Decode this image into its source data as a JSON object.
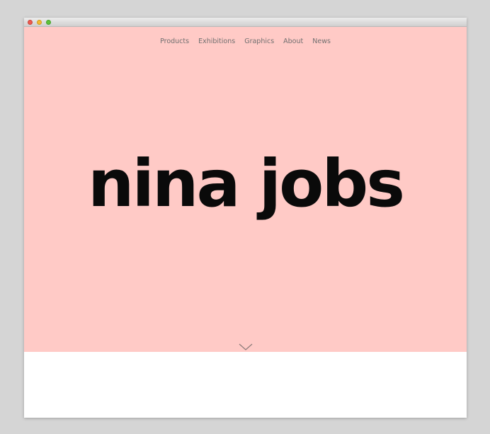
{
  "window": {
    "controls": [
      "close",
      "minimize",
      "zoom"
    ]
  },
  "nav": {
    "items": [
      {
        "label": "Products"
      },
      {
        "label": "Exhibitions"
      },
      {
        "label": "Graphics"
      },
      {
        "label": "About"
      },
      {
        "label": "News"
      }
    ]
  },
  "hero": {
    "logo_text": "nina jobs",
    "background_color": "#ffcac6",
    "scroll_icon": "chevron-down-icon"
  }
}
